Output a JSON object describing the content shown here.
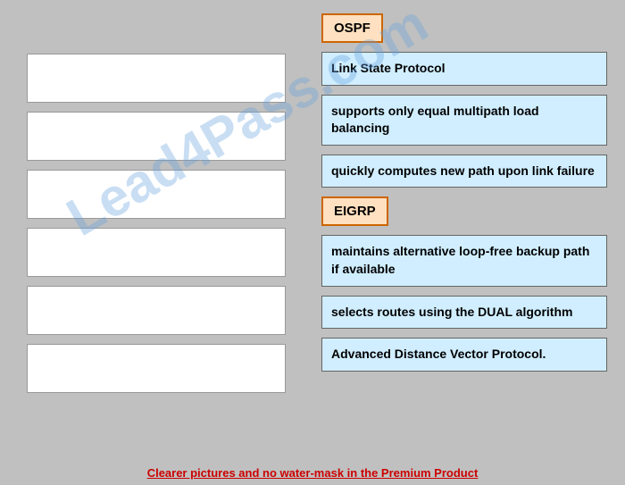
{
  "left_boxes": [
    {
      "id": "box1"
    },
    {
      "id": "box2"
    },
    {
      "id": "box3"
    },
    {
      "id": "box4"
    },
    {
      "id": "box5"
    },
    {
      "id": "box6"
    }
  ],
  "right_items": [
    {
      "type": "label",
      "text": "OSPF",
      "id": "ospf-label"
    },
    {
      "type": "info",
      "text": "Link State Protocol",
      "id": "link-state"
    },
    {
      "type": "info",
      "text": "supports only equal multipath load balancing",
      "id": "multipath"
    },
    {
      "type": "info",
      "text": "quickly computes new path upon link failure",
      "id": "quick-path"
    },
    {
      "type": "label",
      "text": "EIGRP",
      "id": "eigrp-label"
    },
    {
      "type": "info",
      "text": "maintains alternative loop-free backup path if available",
      "id": "loop-free"
    },
    {
      "type": "info",
      "text": "selects routes using the DUAL algorithm",
      "id": "dual-algo"
    },
    {
      "type": "info",
      "text": "Advanced Distance Vector Protocol.",
      "id": "adv-distance"
    }
  ],
  "watermark": "Lead4Pass.com",
  "footer": {
    "text": "Clearer pictures and no water-mask in the Premium Product"
  }
}
